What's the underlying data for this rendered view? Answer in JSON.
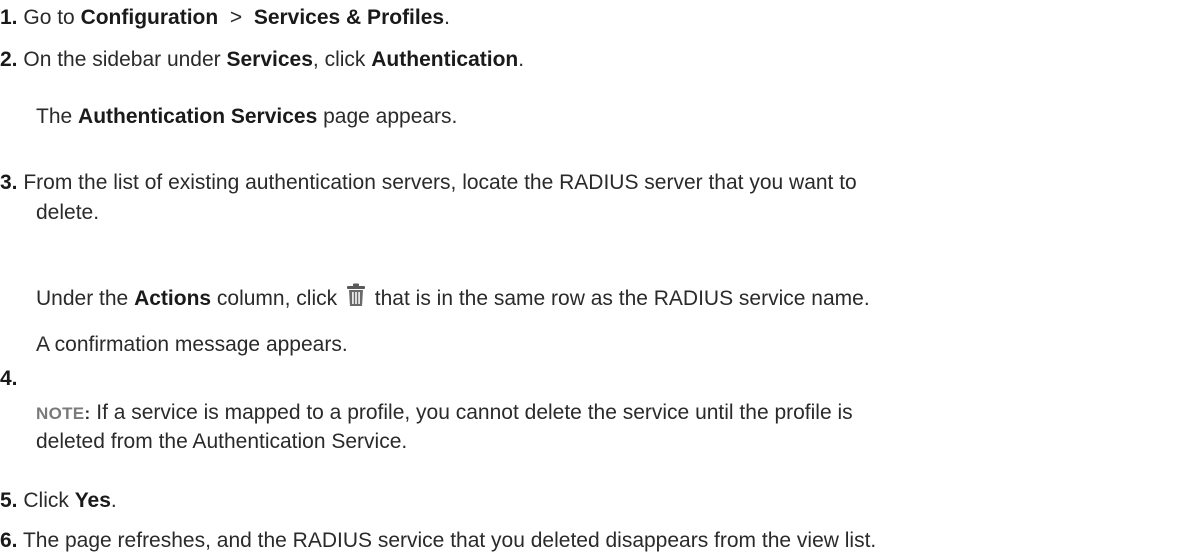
{
  "steps": [
    {
      "number": "1.",
      "parts": [
        "Go to ",
        "Configuration",
        "  >  ",
        "Services & Profiles",
        "."
      ]
    },
    {
      "number": "2.",
      "parts": [
        "On the sidebar under ",
        "Services",
        ", click ",
        "Authentication",
        "."
      ],
      "result_parts": [
        "The ",
        "Authentication Services",
        " page appears."
      ]
    },
    {
      "number": "3.",
      "line1": "From the list of existing authentication servers, locate the RADIUS server that you want to",
      "line2": "delete."
    },
    {
      "number": "4.",
      "parts": [
        "Under the ",
        "Actions",
        " column, click ",
        " that is in the same row as the RADIUS service name."
      ],
      "icon": "trash-icon",
      "result": "A confirmation message appears.",
      "note_label": "NOTE",
      "note_colon": ":",
      "note_line1": " If a service is mapped to a profile, you cannot delete the service until the profile is",
      "note_line2": "deleted from the Authentication Service."
    },
    {
      "number": "5.",
      "parts": [
        "Click ",
        "Yes",
        "."
      ]
    },
    {
      "number": "6.",
      "text": "The page refreshes, and the RADIUS service that you deleted disappears from the view list."
    }
  ],
  "colors": {
    "text": "#2a2a2a",
    "note_label": "#7a7a7a",
    "icon": "#4a4a4a"
  }
}
